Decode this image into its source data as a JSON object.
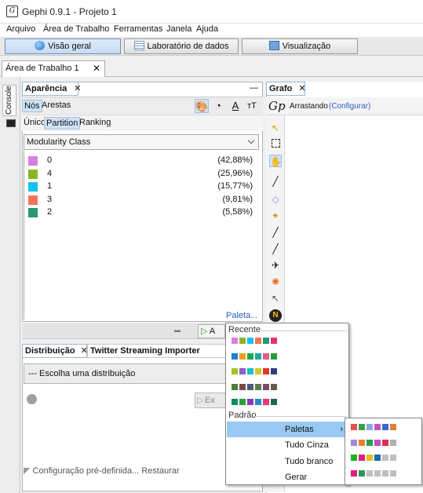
{
  "window": {
    "title": "Gephi 0.9.1 - Projeto 1"
  },
  "menubar": {
    "items": [
      "Arquivo",
      "Área de Trabalho",
      "Ferramentas",
      "Janela",
      "Ajuda"
    ]
  },
  "workspace_tabs": [
    {
      "label": "Visão geral",
      "active": true,
      "icon": "globe-icon"
    },
    {
      "label": "Laboratório de dados",
      "active": false,
      "icon": "table-icon"
    },
    {
      "label": "Visualização",
      "active": false,
      "icon": "monitor-icon"
    }
  ],
  "document_tab": {
    "label": "Área de Trabalho 1",
    "close": "✕"
  },
  "console_label": "Console",
  "appearance": {
    "title": "Aparência",
    "close": "✕",
    "minimize": "—",
    "element_tabs": [
      "Nós",
      "Arestas"
    ],
    "mode_tabs": [
      "Único",
      "Partition",
      "Ranking"
    ],
    "selected_attribute": "Modularity Class",
    "partitions": [
      {
        "label": "0",
        "percent": "(42,88%)",
        "color": "#d97fe0"
      },
      {
        "label": "4",
        "percent": "(25,96%)",
        "color": "#8ab526"
      },
      {
        "label": "1",
        "percent": "(15,77%)",
        "color": "#17c2e8"
      },
      {
        "label": "3",
        "percent": "(9,81%)",
        "color": "#f47556"
      },
      {
        "label": "2",
        "percent": "(5,58%)",
        "color": "#2a9573"
      }
    ],
    "palette_link": "Paleta...",
    "apply_label": "A"
  },
  "distribution": {
    "tabs": [
      "Distribuição",
      "Twitter Streaming Importer"
    ],
    "tab_close": "✕",
    "select_placeholder": "--- Escolha uma distribuição",
    "run_label": "Ex",
    "preset_label": "Configuração pré-definida...",
    "restore_label": "Restaurar"
  },
  "graph": {
    "tab_label": "Grafo",
    "tab_close": "✕",
    "mode_label": "Arrastando",
    "configure_link": "(Configurar)"
  },
  "palette_popup": {
    "recent_header": "Recente",
    "recent_palettes": [
      [
        "#d97fe0",
        "#8ab526",
        "#17c2e8",
        "#f47556",
        "#2a9573",
        "#e8307a"
      ],
      [
        "#1f7fd6",
        "#e8a018",
        "#1fa84f",
        "#1fa8a8",
        "#e65a8a",
        "#2a9d3c"
      ],
      [
        "#a5c31f",
        "#8e5dc6",
        "#19bfc9",
        "#d2c82a",
        "#e23a2a",
        "#2d3f78"
      ],
      [
        "#4f7a3a",
        "#7a4a4a",
        "#4a5a7a",
        "#5a7a4a",
        "#7a4a6a",
        "#6a5a4a"
      ],
      [
        "#0f8a6a",
        "#2aa23a",
        "#8e3ab8",
        "#2a8ac8",
        "#e83a7a",
        "#1f6a4a"
      ]
    ],
    "default_header": "Padrão",
    "menu_items": [
      "Paletas",
      "Tudo Cinza",
      "Tudo branco",
      "Gerar"
    ],
    "highlighted": "Paletas",
    "submenu_palettes": [
      [
        "#e45050",
        "#3aa04a",
        "#8aa8e0",
        "#c055c0",
        "#3a6ad0",
        "#e08030"
      ],
      [
        "#a08ad8",
        "#e88030",
        "#2aa04a",
        "#c050c0",
        "#e03050",
        "#b0b0b0"
      ],
      [
        "#20b020",
        "#e02080",
        "#e0c020",
        "#1a6ab0",
        "#c0c0c0",
        "#c0c0c0"
      ],
      [
        "#e0207a",
        "#2a9a5a",
        "#c0c0c0",
        "#c0c0c0",
        "#c0c0c0",
        "#c0c0c0"
      ]
    ]
  }
}
